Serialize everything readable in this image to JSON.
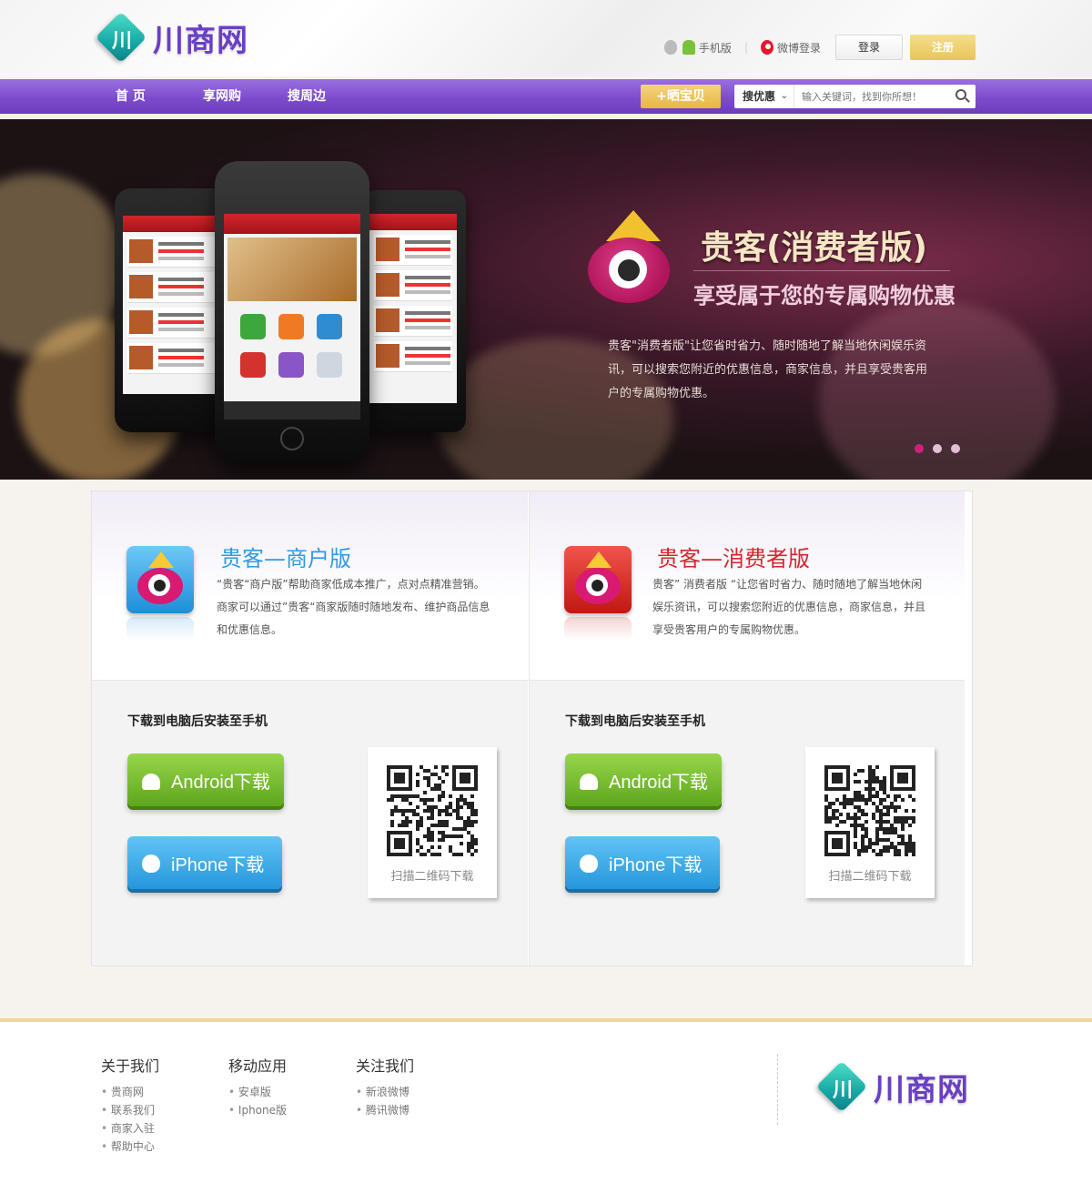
{
  "header": {
    "logo_text": "川商网",
    "logo_glyph": "川",
    "mobile_label": "手机版",
    "weibo_label": "微博登录",
    "login_label": "登录",
    "register_label": "注册"
  },
  "nav": {
    "items": [
      {
        "label": "首 页"
      },
      {
        "label": "享网购"
      },
      {
        "label": "搜周边"
      }
    ],
    "share_button": "+晒宝贝",
    "search": {
      "category": "搜优惠",
      "placeholder": "输入关键词，找到你所想！"
    }
  },
  "banner": {
    "title": "贵客(消费者版)",
    "subtitle": "享受属于您的专属购物优惠",
    "description": "贵客\"消费者版\"让您省时省力、随时随地了解当地休闲娱乐资讯，可以搜索您附近的优惠信息，商家信息，并且享受贵客用户的专属购物优惠。",
    "slide_count": 3,
    "active_slide": 1
  },
  "apps": [
    {
      "title": "贵客—商户版",
      "description": "“贵客“商户版”帮助商家低成本推广，点对点精准营销。商家可以通过”贵客“商家版随时随地发布、维护商品信息和优惠信息。",
      "download_title": "下载到电脑后安装至手机",
      "android_label": "Android下载",
      "iphone_label": "iPhone下载",
      "qr_caption": "扫描二维码下载",
      "color": "#2f9be2"
    },
    {
      "title": "贵客—消费者版",
      "description": "贵客” 消费者版 “让您省时省力、随时随地了解当地休闲娱乐资讯，可以搜索您附近的优惠信息，商家信息，并且享受贵客用户的专属购物优惠。",
      "download_title": "下载到电脑后安装至手机",
      "android_label": "Android下载",
      "iphone_label": "iPhone下载",
      "qr_caption": "扫描二维码下载",
      "color": "#d5262d"
    }
  ],
  "footer": {
    "columns": [
      {
        "title": "关于我们",
        "links": [
          "贵商网",
          "联系我们",
          "商家入驻",
          "帮助中心"
        ]
      },
      {
        "title": "移动应用",
        "links": [
          "安卓版",
          "Iphone版"
        ]
      },
      {
        "title": "关注我们",
        "links": [
          "新浪微博",
          "腾讯微博"
        ]
      }
    ],
    "logo_text": "川商网"
  },
  "colors": {
    "nav_purple": "#7d4ccd",
    "accent_gold": "#e8c55a",
    "android_green": "#6cb42a",
    "iphone_blue": "#2596db",
    "active_dot": "#d11f7e"
  }
}
